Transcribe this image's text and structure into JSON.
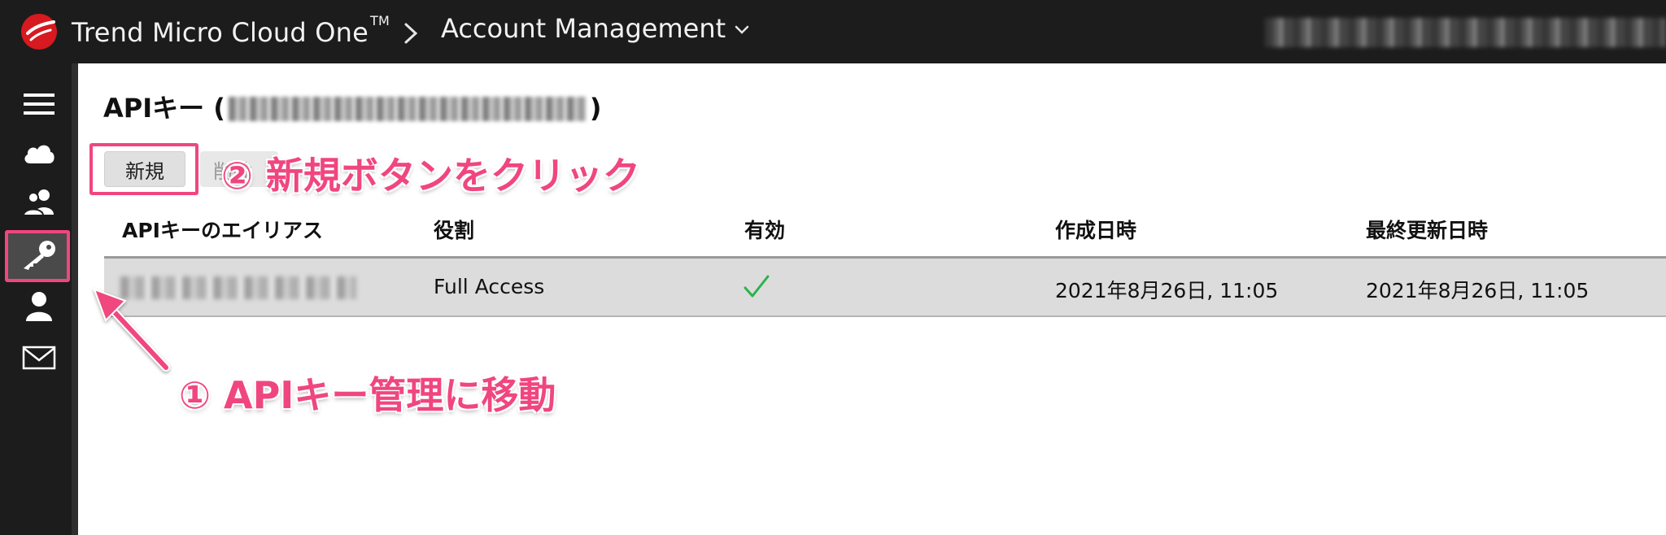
{
  "header": {
    "brand": "Trend Micro Cloud One",
    "brand_tm": "TM",
    "account_menu": "Account Management",
    "user_info_redacted": ""
  },
  "sidebar": {
    "items": [
      {
        "icon": "menu-icon"
      },
      {
        "icon": "cloud-icon"
      },
      {
        "icon": "users-icon"
      },
      {
        "icon": "key-icon",
        "active": true
      },
      {
        "icon": "user-icon"
      },
      {
        "icon": "mail-icon"
      }
    ]
  },
  "page": {
    "title_prefix": "APIキー (",
    "title_suffix": ")"
  },
  "toolbar": {
    "new_label": "新規",
    "delete_label": "削除"
  },
  "table": {
    "columns": [
      "APIキーのエイリアス",
      "役割",
      "有効",
      "作成日時",
      "最終更新日時"
    ],
    "rows": [
      {
        "alias_redacted": "",
        "role": "Full Access",
        "enabled": true,
        "created": "2021年8月26日, 11:05",
        "updated": "2021年8月26日, 11:05"
      }
    ]
  },
  "annotations": {
    "step1": "① APIキー管理に移動",
    "step2": "② 新規ボタンをクリック",
    "color": "#f0467f"
  },
  "colors": {
    "topbar": "#1c1c1c",
    "brand_red": "#d71920",
    "check_green": "#2bb24c",
    "row_bg": "#dcdcdc"
  }
}
